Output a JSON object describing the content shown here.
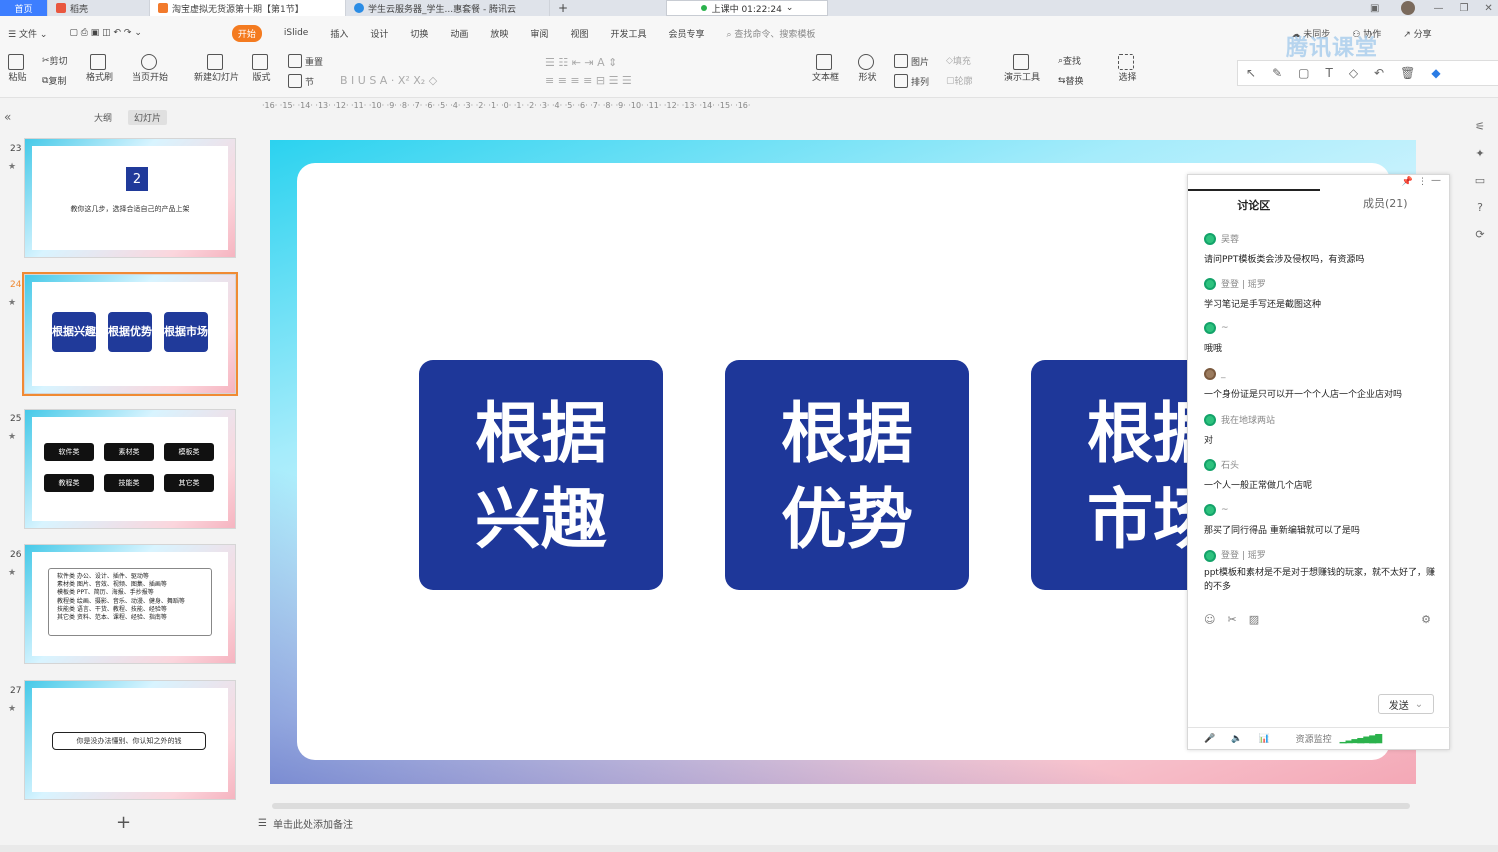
{
  "tabs": [
    {
      "label": "首页"
    },
    {
      "label": "稻壳"
    },
    {
      "label": "淘宝虚拟无货源第十期【第1节】"
    },
    {
      "label": "学生云服务器_学生...惠套餐 - 腾讯云"
    }
  ],
  "new_tab": "+",
  "live": {
    "status": "上课中 01:22:24"
  },
  "menu": {
    "file": "文件",
    "items": [
      "开始",
      "iSlide",
      "插入",
      "设计",
      "切换",
      "动画",
      "放映",
      "审阅",
      "视图",
      "开发工具",
      "会员专享"
    ],
    "search": "查找命令、搜索模板",
    "right": [
      "未同步",
      "协作",
      "分享"
    ]
  },
  "ribbon": {
    "paste": "粘贴",
    "cut": "剪切",
    "copy": "复制",
    "format": "格式刷",
    "from_current": "当页开始",
    "new_slide": "新建幻灯片",
    "layout": "版式",
    "reset": "重置",
    "section": "节",
    "textbox": "文本框",
    "shape": "形状",
    "picture": "图片",
    "arrange": "排列",
    "fill": "填充",
    "outline": "轮廓",
    "present_tools": "演示工具",
    "find": "查找",
    "replace": "替换",
    "select": "选择"
  },
  "ruler_text": "·16·  ·15·  ·14·  ·13·  ·12·  ·11·  ·10·  ·9·  ·8·  ·7·  ·6·  ·5·  ·4·  ·3·  ·2·  ·1·  ·0·  ·1·  ·2·  ·3·  ·4·  ·5·  ·6·  ·7·  ·8·  ·9·  ·10·  ·11·  ·12·  ·13·  ·14·  ·15·  ·16·",
  "panel": {
    "tab_outline": "大纲",
    "tab_slides": "幻灯片",
    "add": "+"
  },
  "thumbs": {
    "t23": {
      "num": "23",
      "box": "2",
      "text": "教你这几步，选择合适自己的产品上架"
    },
    "t24": {
      "num": "24",
      "items": [
        "根据兴趣",
        "根据优势",
        "根据市场"
      ]
    },
    "t25": {
      "num": "25",
      "items": [
        "软件类",
        "素材类",
        "模板类",
        "教程类",
        "技能类",
        "其它类"
      ]
    },
    "t26": {
      "num": "26",
      "lines": [
        "软件类    办公、设计、插件、驱动等",
        "素材类    图片、音效、视频、图集、插画等",
        "模板类    PPT、简历、海报、手抄报等",
        "教程类    绘画、摄影、音乐、动漫、健身、舞蹈等",
        "技能类    语言、干货、教程、技能、经验等",
        "其它类    资料、范本、课程、经验、指南等"
      ]
    },
    "t27": {
      "num": "27",
      "text": "你是没办法懂别、你认知之外的钱"
    }
  },
  "slide": {
    "boxes": [
      {
        "line1": "根据",
        "line2": "兴趣"
      },
      {
        "line1": "根据",
        "line2": "优势"
      },
      {
        "line1": "根据",
        "line2": "市场"
      }
    ]
  },
  "chat": {
    "tab_discuss": "讨论区",
    "tab_members": "成员(21)",
    "messages": [
      {
        "name": "吴蓉",
        "text": "请问PPT模板类会涉及侵权吗，有资源吗"
      },
      {
        "name": "登登 | 瑶罗",
        "text": "学习笔记是手写还是截图这种"
      },
      {
        "name": "~",
        "text": "哦哦"
      },
      {
        "name": "_",
        "text": "一个身份证是只可以开一个个人店一个企业店对吗"
      },
      {
        "name": "我在地球两站",
        "text": "对"
      },
      {
        "name": "石头",
        "text": "一个人一般正常做几个店呢"
      },
      {
        "name": "~",
        "text": "那买了同行得品 重新编辑就可以了是吗"
      },
      {
        "name": "登登 | 瑶罗",
        "text": "ppt模板和素材是不是对于想赚钱的玩家，就不太好了，赚的不多"
      }
    ],
    "send": "发送",
    "monitor": "资源监控"
  },
  "watermark": "腾讯课堂",
  "notes_placeholder": "单击此处添加备注"
}
